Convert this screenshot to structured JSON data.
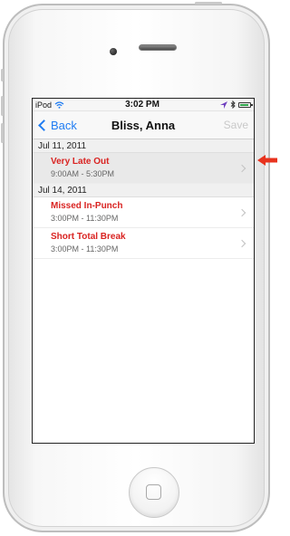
{
  "status_bar": {
    "carrier": "iPod",
    "time": "3:02 PM",
    "icons": [
      "wifi-icon",
      "location-arrow-icon",
      "bluetooth-icon",
      "battery-icon"
    ]
  },
  "nav": {
    "back_label": "Back",
    "title": "Bliss, Anna",
    "save_label": "Save"
  },
  "sections": [
    {
      "date": "Jul 11, 2011",
      "rows": [
        {
          "exception": "Very Late Out",
          "hours": "9:00AM - 5:30PM"
        }
      ]
    },
    {
      "date": "Jul 14, 2011",
      "rows": [
        {
          "exception": "Missed In-Punch",
          "hours": "3:00PM - 11:30PM"
        },
        {
          "exception": "Short Total Break",
          "hours": "3:00PM - 11:30PM"
        }
      ]
    }
  ],
  "colors": {
    "accent": "#1f7cf2",
    "exception": "#d92321",
    "pointer": "#e8331e"
  }
}
